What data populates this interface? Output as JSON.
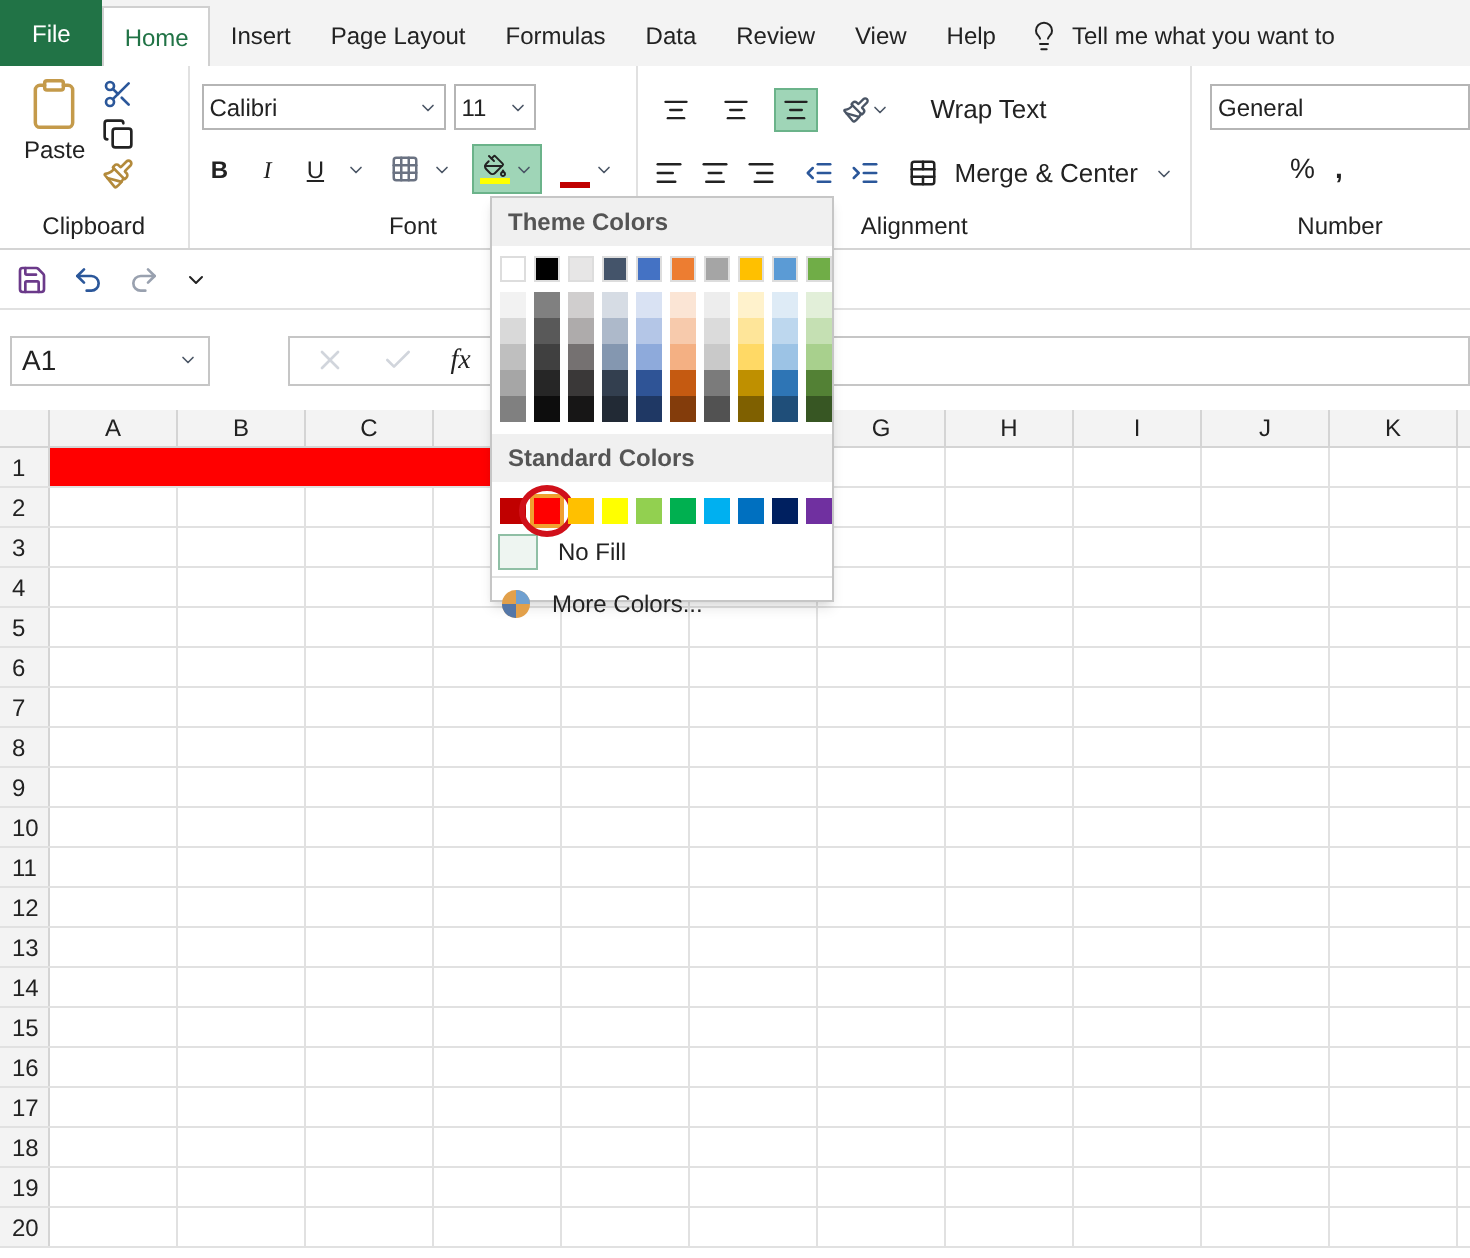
{
  "tabs": [
    {
      "label": "File",
      "kind": "file",
      "selected": false
    },
    {
      "label": "Home",
      "kind": "tab",
      "selected": true
    },
    {
      "label": "Insert",
      "kind": "tab",
      "selected": false
    },
    {
      "label": "Page Layout",
      "kind": "tab",
      "selected": false
    },
    {
      "label": "Formulas",
      "kind": "tab",
      "selected": false
    },
    {
      "label": "Data",
      "kind": "tab",
      "selected": false
    },
    {
      "label": "Review",
      "kind": "tab",
      "selected": false
    },
    {
      "label": "View",
      "kind": "tab",
      "selected": false
    },
    {
      "label": "Help",
      "kind": "tab",
      "selected": false
    }
  ],
  "tell_me": "Tell me what you want to",
  "ribbon": {
    "clipboard": {
      "paste": "Paste",
      "label": "Clipboard"
    },
    "font": {
      "name": "Calibri",
      "size": "11",
      "bold": "B",
      "italic": "I",
      "underline": "U",
      "fill_open": true,
      "label": "Font"
    },
    "alignment": {
      "wrap": "Wrap Text",
      "merge": "Merge & Center",
      "bottom_align_selected": true,
      "label": "Alignment"
    },
    "number": {
      "format": "General",
      "percent": "%",
      "comma": ",",
      "label": "Number"
    }
  },
  "name_box": "A1",
  "fx": "fx",
  "columns": [
    "A",
    "B",
    "C",
    null,
    null,
    null,
    "G",
    "H",
    "I",
    "J",
    "K"
  ],
  "rows": [
    {
      "label": "1",
      "cells": [
        {
          "color": "#ff0000"
        },
        {
          "color": "#ff0000"
        },
        {
          "color": "#ff0000"
        },
        {
          "color": "#ff0000"
        }
      ]
    },
    {
      "label": "2"
    },
    {
      "label": "3"
    },
    {
      "label": "4"
    },
    {
      "label": "5"
    },
    {
      "label": "6"
    },
    {
      "label": "7"
    },
    {
      "label": "8"
    },
    {
      "label": "9"
    },
    {
      "label": "10"
    },
    {
      "label": "11"
    },
    {
      "label": "12"
    },
    {
      "label": "13"
    },
    {
      "label": "14"
    },
    {
      "label": "15"
    },
    {
      "label": "16"
    },
    {
      "label": "17"
    },
    {
      "label": "18"
    },
    {
      "label": "19"
    },
    {
      "label": "20"
    }
  ],
  "color_menu": {
    "theme_title": "Theme Colors",
    "theme_colors": [
      {
        "color": "#ffffff",
        "shades": [
          {
            "color": "#f2f2f2"
          },
          {
            "color": "#d9d9d9"
          },
          {
            "color": "#bfbfbf"
          },
          {
            "color": "#a6a6a6"
          },
          {
            "color": "#808080"
          }
        ]
      },
      {
        "color": "#000000",
        "shades": [
          {
            "color": "#808080"
          },
          {
            "color": "#595959"
          },
          {
            "color": "#404040"
          },
          {
            "color": "#262626"
          },
          {
            "color": "#0d0d0d"
          }
        ]
      },
      {
        "color": "#e7e6e6",
        "shades": [
          {
            "color": "#d0cece"
          },
          {
            "color": "#aeabab"
          },
          {
            "color": "#757171"
          },
          {
            "color": "#3a3838"
          },
          {
            "color": "#171616"
          }
        ]
      },
      {
        "color": "#44546a",
        "shades": [
          {
            "color": "#d6dce4"
          },
          {
            "color": "#adb9ca"
          },
          {
            "color": "#8497b0"
          },
          {
            "color": "#333f4f"
          },
          {
            "color": "#222a35"
          }
        ]
      },
      {
        "color": "#4472c4",
        "shades": [
          {
            "color": "#d9e2f3"
          },
          {
            "color": "#b4c6e7"
          },
          {
            "color": "#8eaadb"
          },
          {
            "color": "#2f5496"
          },
          {
            "color": "#1f3864"
          }
        ]
      },
      {
        "color": "#ed7d31",
        "shades": [
          {
            "color": "#fbe5d5"
          },
          {
            "color": "#f7caac"
          },
          {
            "color": "#f4b083"
          },
          {
            "color": "#c55a11"
          },
          {
            "color": "#833c0b"
          }
        ]
      },
      {
        "color": "#a5a5a5",
        "shades": [
          {
            "color": "#ededed"
          },
          {
            "color": "#dbdbdb"
          },
          {
            "color": "#c9c9c9"
          },
          {
            "color": "#7b7b7b"
          },
          {
            "color": "#525252"
          }
        ]
      },
      {
        "color": "#ffc000",
        "shades": [
          {
            "color": "#fff2cc"
          },
          {
            "color": "#fee599"
          },
          {
            "color": "#ffd965"
          },
          {
            "color": "#bf9000"
          },
          {
            "color": "#7f6000"
          }
        ]
      },
      {
        "color": "#5b9bd5",
        "shades": [
          {
            "color": "#deebf6"
          },
          {
            "color": "#bdd7ee"
          },
          {
            "color": "#9cc3e5"
          },
          {
            "color": "#2e75b5"
          },
          {
            "color": "#1f4e79"
          }
        ]
      },
      {
        "color": "#70ad47",
        "shades": [
          {
            "color": "#e2efd9"
          },
          {
            "color": "#c5e0b3"
          },
          {
            "color": "#a8d08d"
          },
          {
            "color": "#538135"
          },
          {
            "color": "#375623"
          }
        ]
      }
    ],
    "standard_title": "Standard Colors",
    "standard_colors": [
      {
        "color": "#c00000",
        "selected": false
      },
      {
        "color": "#ff0000",
        "selected": true
      },
      {
        "color": "#ffc000",
        "selected": false
      },
      {
        "color": "#ffff00",
        "selected": false
      },
      {
        "color": "#92d050",
        "selected": false
      },
      {
        "color": "#00b050",
        "selected": false
      },
      {
        "color": "#00b0f0",
        "selected": false
      },
      {
        "color": "#0070c0",
        "selected": false
      },
      {
        "color": "#002060",
        "selected": false
      },
      {
        "color": "#7030a0",
        "selected": false
      }
    ],
    "no_fill": "No Fill",
    "more": "More Colors..."
  }
}
